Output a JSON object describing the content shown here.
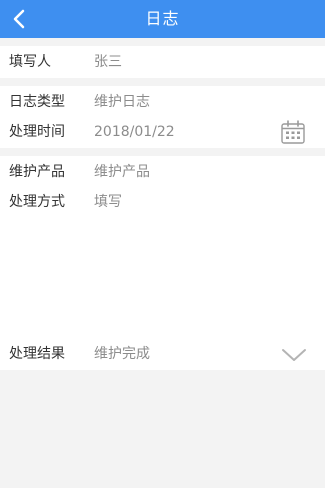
{
  "header": {
    "title": "日志",
    "bg_color": "#3e8ff0"
  },
  "section1": {
    "filler_label": "填写人",
    "filler_value": "张三"
  },
  "section2": {
    "log_type_label": "日志类型",
    "log_type_value": "维护日志",
    "time_label": "处理时间",
    "time_value": "2018/01/22",
    "calendar_icon": "calendar-icon"
  },
  "section3": {
    "product_label": "维护产品",
    "product_placeholder": "维护产品",
    "method_label": "处理方式",
    "method_placeholder": "填写",
    "result_label": "处理结果",
    "result_value": "维护完成",
    "dropdown_icon": "chevron-down-icon"
  }
}
